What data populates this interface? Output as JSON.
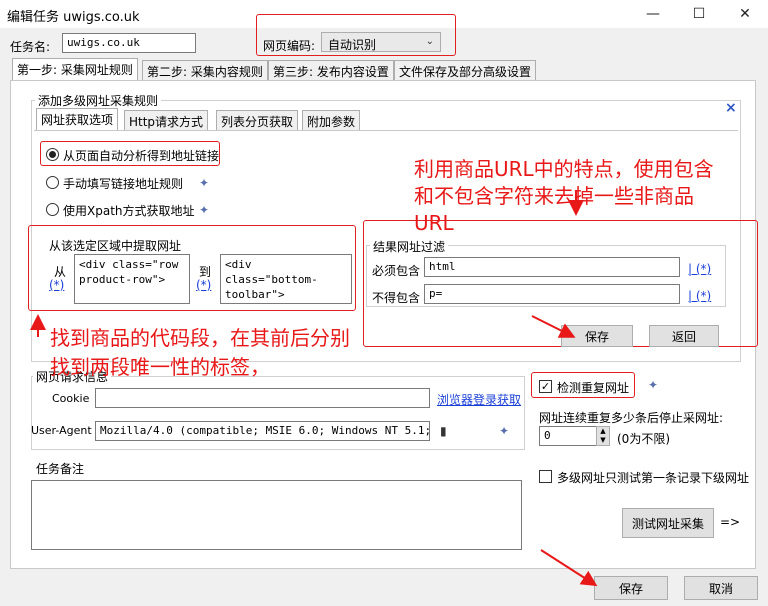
{
  "window": {
    "title": "编辑任务 uwigs.co.uk",
    "minimize": "—",
    "maximize": "☐",
    "close": "✕"
  },
  "task": {
    "name_label": "任务名:",
    "name_value": "uwigs.co.uk"
  },
  "encoding": {
    "label": "网页编码:",
    "value": "自动识别"
  },
  "main_tabs": [
    {
      "label": "第一步: 采集网址规则"
    },
    {
      "label": "第二步: 采集内容规则"
    },
    {
      "label": "第三步: 发布内容设置"
    },
    {
      "label": "文件保存及部分高级设置"
    }
  ],
  "multi_level": {
    "title": "添加多级网址采集规则",
    "close": "×"
  },
  "sub_tabs": [
    {
      "label": "网址获取选项"
    },
    {
      "label": "Http请求方式"
    },
    {
      "label": "列表分页获取"
    },
    {
      "label": "附加参数"
    }
  ],
  "options": [
    {
      "label": "从页面自动分析得到地址链接"
    },
    {
      "label": "手动填写链接地址规则"
    },
    {
      "label": "使用Xpath方式获取地址"
    }
  ],
  "extract": {
    "title": "从该选定区域中提取网址",
    "from_label": "从",
    "from_link": "(*)",
    "from_value": "<div class=\"row\nproduct-row\">",
    "to_label": "到",
    "to_link": "(*)",
    "to_value": "<div class=\"bottom-\ntoolbar\">"
  },
  "filter": {
    "title": "结果网址过滤",
    "must_label": "必须包含",
    "must_value": "html",
    "must_links": "| (*)",
    "not_label": "不得包含",
    "not_value": "p=",
    "not_links": "| (*)",
    "save": "保存",
    "back": "返回"
  },
  "request": {
    "title": "网页请求信息",
    "cookie_label": "Cookie",
    "cookie_value": "",
    "browser_login": "浏览器登录获取",
    "ua_label": "User-Agent",
    "ua_value": "Mozilla/4.0 (compatible; MSIE 6.0; Windows NT 5.1; SV1; ."
  },
  "dedupe": {
    "check_label": "检测重复网址",
    "stop_label": "网址连续重复多少条后停止采网址:",
    "stop_value": "0",
    "stop_hint": "(0为不限)"
  },
  "notes": {
    "title": "任务备注",
    "value": ""
  },
  "test_first": {
    "label": "多级网址只测试第一条记录下级网址"
  },
  "test_button": "测试网址采集",
  "test_arrow": "=>",
  "footer": {
    "save": "保存",
    "cancel": "取消"
  },
  "annotations": {
    "right_line1": "利用商品URL中的特点，使用包含",
    "right_line2": "和不包含字符来去掉一些非商品",
    "right_line3": "URL",
    "left_line1": "找到商品的代码段，在其前后分别",
    "left_line2": "找到两段唯一性的标签，"
  },
  "colors": {
    "annotation": "#e81818",
    "link": "#1a3fd6"
  }
}
